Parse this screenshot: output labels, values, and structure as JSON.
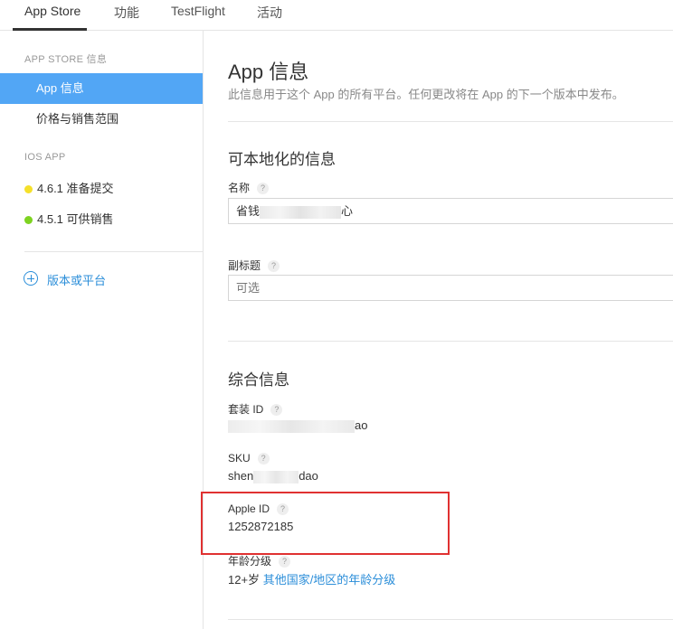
{
  "topnav": {
    "tabs": [
      {
        "label": "App Store",
        "active": true
      },
      {
        "label": "功能"
      },
      {
        "label": "TestFlight"
      },
      {
        "label": "活动"
      }
    ]
  },
  "sidebar": {
    "section_store": "APP STORE 信息",
    "items": [
      {
        "label": "App 信息",
        "active": true
      },
      {
        "label": "价格与销售范围"
      }
    ],
    "section_ios": "IOS APP",
    "versions": [
      {
        "label": "4.6.1 准备提交",
        "color": "#f5e02a"
      },
      {
        "label": "4.5.1 可供销售",
        "color": "#7ed321"
      }
    ],
    "add_platform": "版本或平台"
  },
  "main": {
    "title": "App 信息",
    "subtitle": "此信息用于这个 App 的所有平台。任何更改将在 App 的下一个版本中发布。",
    "localizable": {
      "title": "可本地化的信息",
      "name_label": "名称",
      "name_value_start": "省钱",
      "name_value_end": "心",
      "subtitle_label": "副标题",
      "subtitle_placeholder": "可选"
    },
    "general": {
      "title": "综合信息",
      "bundle_label": "套装 ID",
      "bundle_value_end": "ao",
      "sku_label": "SKU",
      "sku_value_start": "shen",
      "sku_value_end": "dao",
      "apple_id_label": "Apple ID",
      "apple_id_value": "1252872185",
      "age_label": "年龄分级",
      "age_value": "12+岁",
      "age_link": "其他国家/地区的年龄分级"
    },
    "help": "?"
  }
}
